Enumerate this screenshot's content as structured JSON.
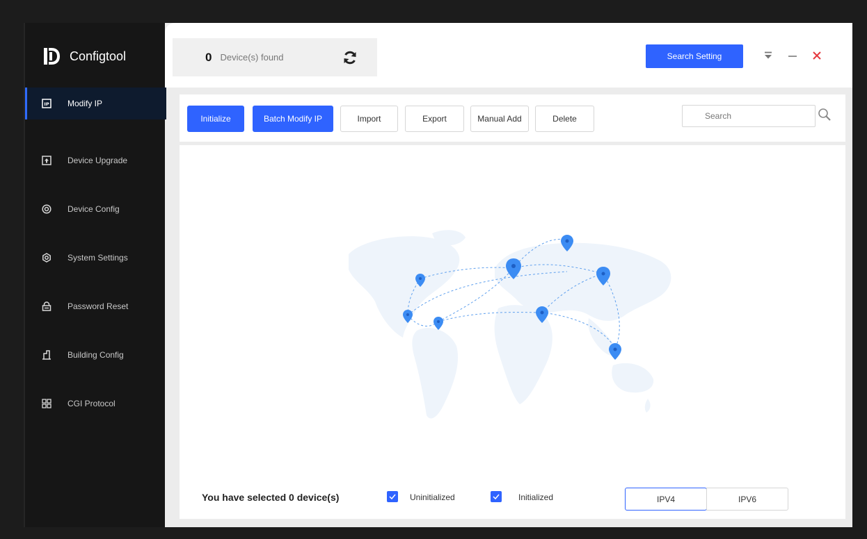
{
  "app": {
    "title": "Configtool"
  },
  "sidebar": {
    "items": [
      {
        "label": "Modify IP",
        "icon": "ip-icon",
        "active": true
      },
      {
        "label": "Device Upgrade",
        "icon": "upgrade-icon"
      },
      {
        "label": "Device Config",
        "icon": "config-icon"
      },
      {
        "label": "System Settings",
        "icon": "settings-icon"
      },
      {
        "label": "Password Reset",
        "icon": "lock-icon"
      },
      {
        "label": "Building Config",
        "icon": "building-icon"
      },
      {
        "label": "CGI Protocol",
        "icon": "grid-icon"
      }
    ]
  },
  "header": {
    "device_count": "0",
    "device_found_label": "Device(s) found",
    "search_setting_label": "Search Setting"
  },
  "toolbar": {
    "initialize": "Initialize",
    "batch_modify_ip": "Batch Modify IP",
    "import": "Import",
    "export": "Export",
    "manual_add": "Manual Add",
    "delete": "Delete",
    "search_placeholder": "Search"
  },
  "footer": {
    "selected_text": "You have selected 0  device(s)",
    "uninitialized_label": "Uninitialized",
    "initialized_label": "Initialized",
    "ipv4_label": "IPV4",
    "ipv6_label": "IPV6"
  },
  "colors": {
    "accent": "#2f63ff",
    "sidebar_bg": "#161616",
    "close": "#e5393f",
    "map_pin": "#3c8cf3"
  }
}
